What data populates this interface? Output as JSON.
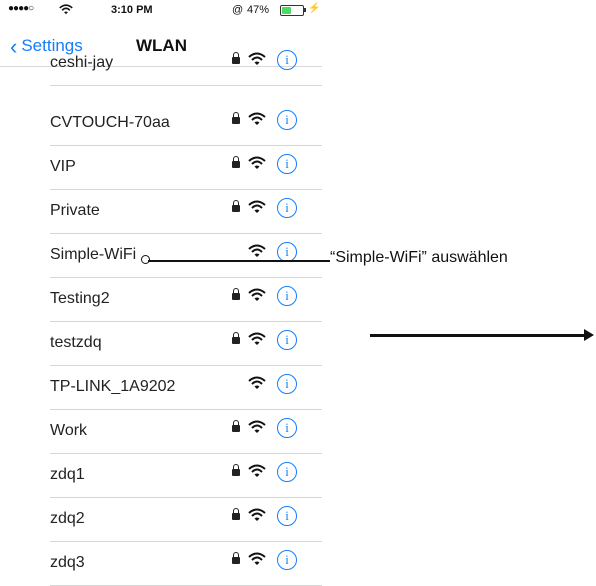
{
  "status_bar": {
    "signal": "●●●●○",
    "time": "3:10 PM",
    "alarm_icon": "@",
    "battery_percent": "47%",
    "battery_level": 0.47,
    "charge_glyph": "⚡"
  },
  "nav": {
    "back_label": "Settings",
    "title": "WLAN"
  },
  "networks": [
    {
      "name": "ceshi-jay",
      "locked": true
    },
    {
      "name": "CVTOUCH-70aa",
      "locked": true
    },
    {
      "name": "VIP",
      "locked": true
    },
    {
      "name": "Private",
      "locked": true
    },
    {
      "name": "Simple-WiFi",
      "locked": false
    },
    {
      "name": "Testing2",
      "locked": true
    },
    {
      "name": "testzdq",
      "locked": true
    },
    {
      "name": "TP-LINK_1A9202",
      "locked": false
    },
    {
      "name": "Work",
      "locked": true
    },
    {
      "name": "zdq1",
      "locked": true
    },
    {
      "name": "zdq2",
      "locked": true
    },
    {
      "name": "zdq3",
      "locked": true
    }
  ],
  "annotation": {
    "callout": "“Simple-WiFi” auswählen"
  },
  "colors": {
    "accent": "#147efb",
    "battery": "#4cd964"
  }
}
